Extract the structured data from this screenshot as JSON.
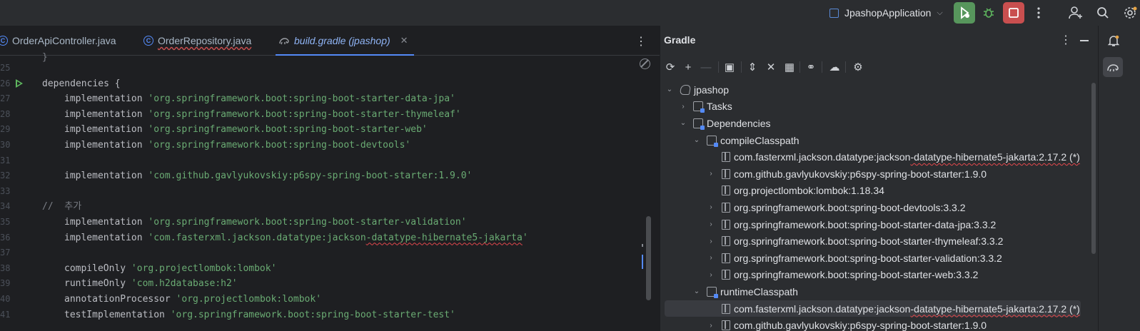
{
  "toolbar": {
    "run_config": "JpashopApplication"
  },
  "editor": {
    "tabs": [
      {
        "label": "OrderApiController.java"
      },
      {
        "label": "OrderRepository.java"
      },
      {
        "label": "build.gradle (jpashop)"
      }
    ],
    "lines": [
      {
        "num": "25",
        "text": ""
      },
      {
        "num": "26",
        "text": "dependencies {"
      },
      {
        "num": "27",
        "text": "implementation ",
        "str": "'org.springframework.boot:spring-boot-starter-data-jpa'"
      },
      {
        "num": "28",
        "text": "implementation ",
        "str": "'org.springframework.boot:spring-boot-starter-thymeleaf'"
      },
      {
        "num": "29",
        "text": "implementation ",
        "str": "'org.springframework.boot:spring-boot-starter-web'"
      },
      {
        "num": "30",
        "text": "implementation ",
        "str": "'org.springframework.boot:spring-boot-devtools'"
      },
      {
        "num": "31",
        "text": ""
      },
      {
        "num": "32",
        "text": "implementation ",
        "str": "'com.github.gavlyukovskiy:p6spy-spring-boot-starter:1.9.0'"
      },
      {
        "num": "33",
        "text": ""
      },
      {
        "num": "34",
        "comment": "//  추가"
      },
      {
        "num": "35",
        "text": "implementation ",
        "str": "'org.springframework.boot:spring-boot-starter-validation'"
      },
      {
        "num": "36",
        "text": "implementation ",
        "str_a": "'com.fasterxml.jackson.datatype:jackson",
        "str_b": "-datatype-hibernate5-jakarta",
        "str_c": "'"
      },
      {
        "num": "37",
        "text": ""
      },
      {
        "num": "38",
        "text": "compileOnly ",
        "str": "'org.projectlombok:lombok'"
      },
      {
        "num": "39",
        "text": "runtimeOnly ",
        "str": "'com.h2database:h2'"
      },
      {
        "num": "40",
        "text": "annotationProcessor ",
        "str": "'org.projectlombok:lombok'"
      },
      {
        "num": "41",
        "text": "testImplementation ",
        "str": "'org.springframework.boot:spring-boot-starter-test'"
      }
    ]
  },
  "gradle": {
    "title": "Gradle",
    "tree": [
      {
        "label": "jpashop"
      },
      {
        "label": "Tasks"
      },
      {
        "label": "Dependencies"
      },
      {
        "label": "compileClasspath"
      },
      {
        "label_a": "com.fasterxml.jackson.datatype:jackson",
        "label_b": "-datatype-hibernate5-jakarta:2.17.2 (*)"
      },
      {
        "label": "com.github.gavlyukovskiy:p6spy-spring-boot-starter:1.9.0"
      },
      {
        "label": "org.projectlombok:lombok:1.18.34"
      },
      {
        "label": "org.springframework.boot:spring-boot-devtools:3.3.2"
      },
      {
        "label": "org.springframework.boot:spring-boot-starter-data-jpa:3.3.2"
      },
      {
        "label": "org.springframework.boot:spring-boot-starter-thymeleaf:3.3.2"
      },
      {
        "label": "org.springframework.boot:spring-boot-starter-validation:3.3.2"
      },
      {
        "label": "org.springframework.boot:spring-boot-starter-web:3.3.2"
      },
      {
        "label": "runtimeClasspath"
      },
      {
        "label_a": "com.fasterxml.jackson.datatype:jackson",
        "label_b": "-datatype-hibernate5-jakarta:2.17.2 (*)"
      },
      {
        "label": "com.github.gavlyukovskiy:p6spy-spring-boot-starter:1.9.0"
      }
    ]
  },
  "colors": {
    "run": "#57965c",
    "stop": "#c94f4f",
    "accent": "#548af7",
    "string": "#6aab73"
  },
  "icons": [
    "run-icon",
    "debug-icon",
    "stop-icon",
    "more-icon",
    "add-user-icon",
    "search-icon",
    "settings-icon",
    "bell-icon",
    "gradle-elephant-icon"
  ]
}
